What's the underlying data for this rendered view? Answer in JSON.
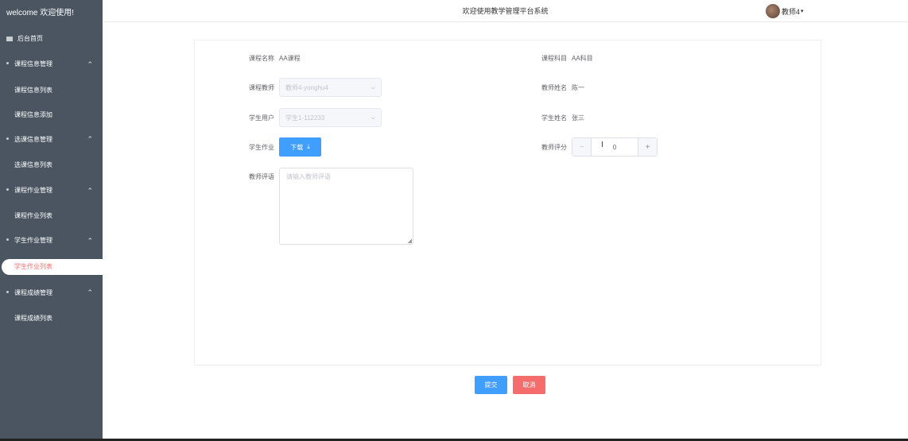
{
  "sidebar": {
    "welcome": "welcome 欢迎使用!",
    "home": "后台首页",
    "groups": [
      {
        "label": "课程信息管理",
        "items": [
          "课程信息列表",
          "课程信息添加"
        ]
      },
      {
        "label": "选课信息管理",
        "items": [
          "选课信息列表"
        ]
      },
      {
        "label": "课程作业管理",
        "items": [
          "课程作业列表"
        ]
      },
      {
        "label": "学生作业管理",
        "items": [
          "学生作业列表"
        ]
      },
      {
        "label": "课程成绩管理",
        "items": [
          "课程成绩列表"
        ]
      }
    ],
    "active_item": "学生作业列表"
  },
  "header": {
    "title": "欢迎使用教学管理平台系统",
    "user_name": "教师4"
  },
  "form": {
    "course_name": {
      "label": "课程名称",
      "value": "AA课程"
    },
    "course_subject": {
      "label": "课程科目",
      "value": "AA科目"
    },
    "course_teacher": {
      "label": "课程教师",
      "value": "教师4-yonghu4"
    },
    "teacher_name": {
      "label": "教师姓名",
      "value": "陈一"
    },
    "student_user": {
      "label": "学生用户",
      "value": "学生1-112233"
    },
    "student_name": {
      "label": "学生姓名",
      "value": "张三"
    },
    "student_homework": {
      "label": "学生作业",
      "button": "下载"
    },
    "teacher_score": {
      "label": "教师评分",
      "value": "0"
    },
    "teacher_comment": {
      "label": "教师评语",
      "placeholder": "请输入教师评语"
    }
  },
  "actions": {
    "submit": "提交",
    "cancel": "取消"
  },
  "colors": {
    "sidebar_bg": "#4a5561",
    "primary": "#409eff",
    "danger": "#f56c6c",
    "active_text": "#f56c6c"
  }
}
